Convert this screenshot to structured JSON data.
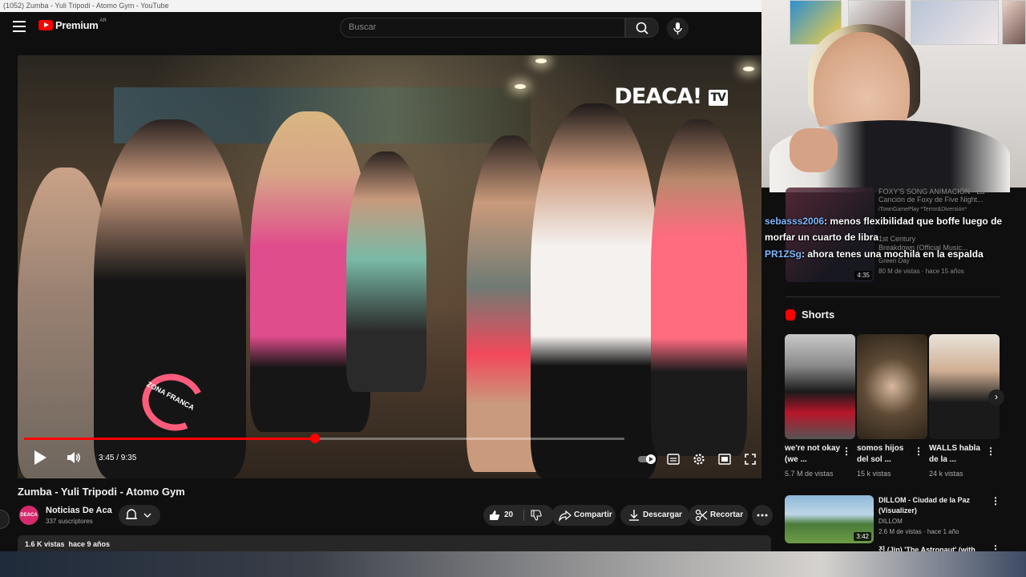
{
  "window": {
    "title": "(1052) Zumba - Yuli Tripodi - Atomo Gym - YouTube"
  },
  "header": {
    "logo_text": "Premium",
    "country": "AR",
    "search_placeholder": "Buscar"
  },
  "player": {
    "watermark": "DEACA!",
    "watermark_badge": "TV",
    "time_display": "3:45 / 9:35",
    "progress_fraction": 0.485,
    "overlay_text": "ZONA FRANCA"
  },
  "video": {
    "title": "Zumba - Yuli Tripodi - Atomo Gym",
    "channel_name": "Noticias De Aca",
    "channel_avatar_text": "DEACA",
    "subscribers": "337 suscriptores",
    "likes": "20",
    "share_label": "Compartir",
    "download_label": "Descargar",
    "clip_label": "Recortar",
    "views_date": "1.6 K vistas  hace 9 años"
  },
  "chat": [
    {
      "user": "sebasss2006",
      "message": ": menos flexibilidad que boffe luego de morfar un cuarto de libra"
    },
    {
      "user": "PR1ZSg",
      "message": ": ahora tenes una mochila en la espalda"
    }
  ],
  "sidebar": {
    "ghost_lines": [
      "FOXY'S SONG ANIMACIÓN - La",
      "Canción de Foxy de Five Night...",
      "iTownGamePlay *Terror&Diversión*",
      "1st Century",
      "Breakdown (Official Music...",
      "Green Day",
      "80 M de vistas · hace 15 años"
    ],
    "ghost_duration": "4:35",
    "shorts_label": "Shorts",
    "shorts": [
      {
        "title": "we're not okay (we ...",
        "views": "5.7 M de vistas"
      },
      {
        "title": "somos hijos del sol ...",
        "views": "15 k vistas"
      },
      {
        "title": "WALLS habla de la ...",
        "views": "24 k vistas"
      }
    ],
    "recommended": {
      "title": "DILLOM - Ciudad de la Paz (Visualizer)",
      "channel": "DILLOM",
      "meta": "2.6 M de vistas · hace 1 año",
      "duration": "3:42",
      "next_title": "진 (Jin) 'The Astronaut' (with"
    }
  },
  "colors": {
    "accent": "#ff0000",
    "bg": "#0f0f0f",
    "chip": "#272727"
  }
}
